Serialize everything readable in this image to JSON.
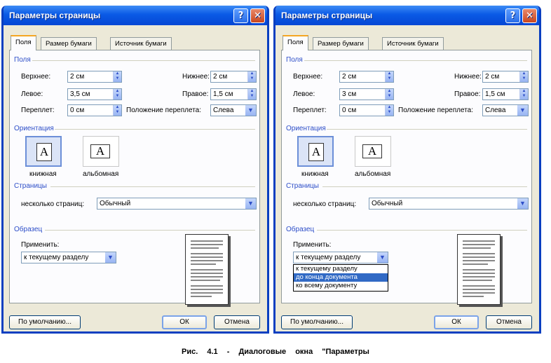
{
  "dialogs": [
    {
      "title": "Параметры страницы",
      "tabs": [
        "Поля",
        "Размер бумаги",
        "Источник бумаги"
      ],
      "margins": {
        "group": "Поля",
        "top_label": "Верхнее:",
        "top_value": "2 см",
        "bottom_label": "Нижнее:",
        "bottom_value": "2 см",
        "left_label": "Левое:",
        "left_value": "3,5 см",
        "right_label": "Правое:",
        "right_value": "1,5 см",
        "gutter_label": "Переплет:",
        "gutter_value": "0 см",
        "gutter_pos_label": "Положение переплета:",
        "gutter_pos_value": "Слева"
      },
      "orientation": {
        "group": "Ориентация",
        "portrait": "книжная",
        "landscape": "альбомная",
        "glyph": "A"
      },
      "pages": {
        "group": "Страницы",
        "multiple_label": "несколько страниц:",
        "multiple_value": "Обычный"
      },
      "sample": {
        "group": "Образец",
        "apply_label": "Применить:",
        "apply_value": "к текущему разделу"
      },
      "buttons": {
        "default": "По умолчанию...",
        "ok": "ОК",
        "cancel": "Отмена"
      },
      "help_glyph": "?",
      "close_glyph": "✕"
    },
    {
      "title": "Параметры страницы",
      "tabs": [
        "Поля",
        "Размер бумаги",
        "Источник бумаги"
      ],
      "margins": {
        "group": "Поля",
        "top_label": "Верхнее:",
        "top_value": "2 см",
        "bottom_label": "Нижнее:",
        "bottom_value": "2 см",
        "left_label": "Левое:",
        "left_value": "3 см",
        "right_label": "Правое:",
        "right_value": "1,5 см",
        "gutter_label": "Переплет:",
        "gutter_value": "0 см",
        "gutter_pos_label": "Положение переплета:",
        "gutter_pos_value": "Слева"
      },
      "orientation": {
        "group": "Ориентация",
        "portrait": "книжная",
        "landscape": "альбомная",
        "glyph": "A"
      },
      "pages": {
        "group": "Страницы",
        "multiple_label": "несколько страниц:",
        "multiple_value": "Обычный"
      },
      "sample": {
        "group": "Образец",
        "apply_label": "Применить:",
        "apply_value": "к текущему разделу",
        "options": [
          "к текущему разделу",
          "до конца документа",
          "ко всему документу"
        ],
        "highlighted_option": "до конца документа"
      },
      "buttons": {
        "default": "По умолчанию...",
        "ok": "ОК",
        "cancel": "Отмена"
      },
      "help_glyph": "?",
      "close_glyph": "✕"
    }
  ],
  "caption": "Рис. 4.1 - Диалоговые окна \"Параметры",
  "colors": {
    "title_bar": "#0a5ae6",
    "highlight": "#316ac5",
    "group_label": "#2d4ec8",
    "dialog_bg": "#ece9d8"
  }
}
